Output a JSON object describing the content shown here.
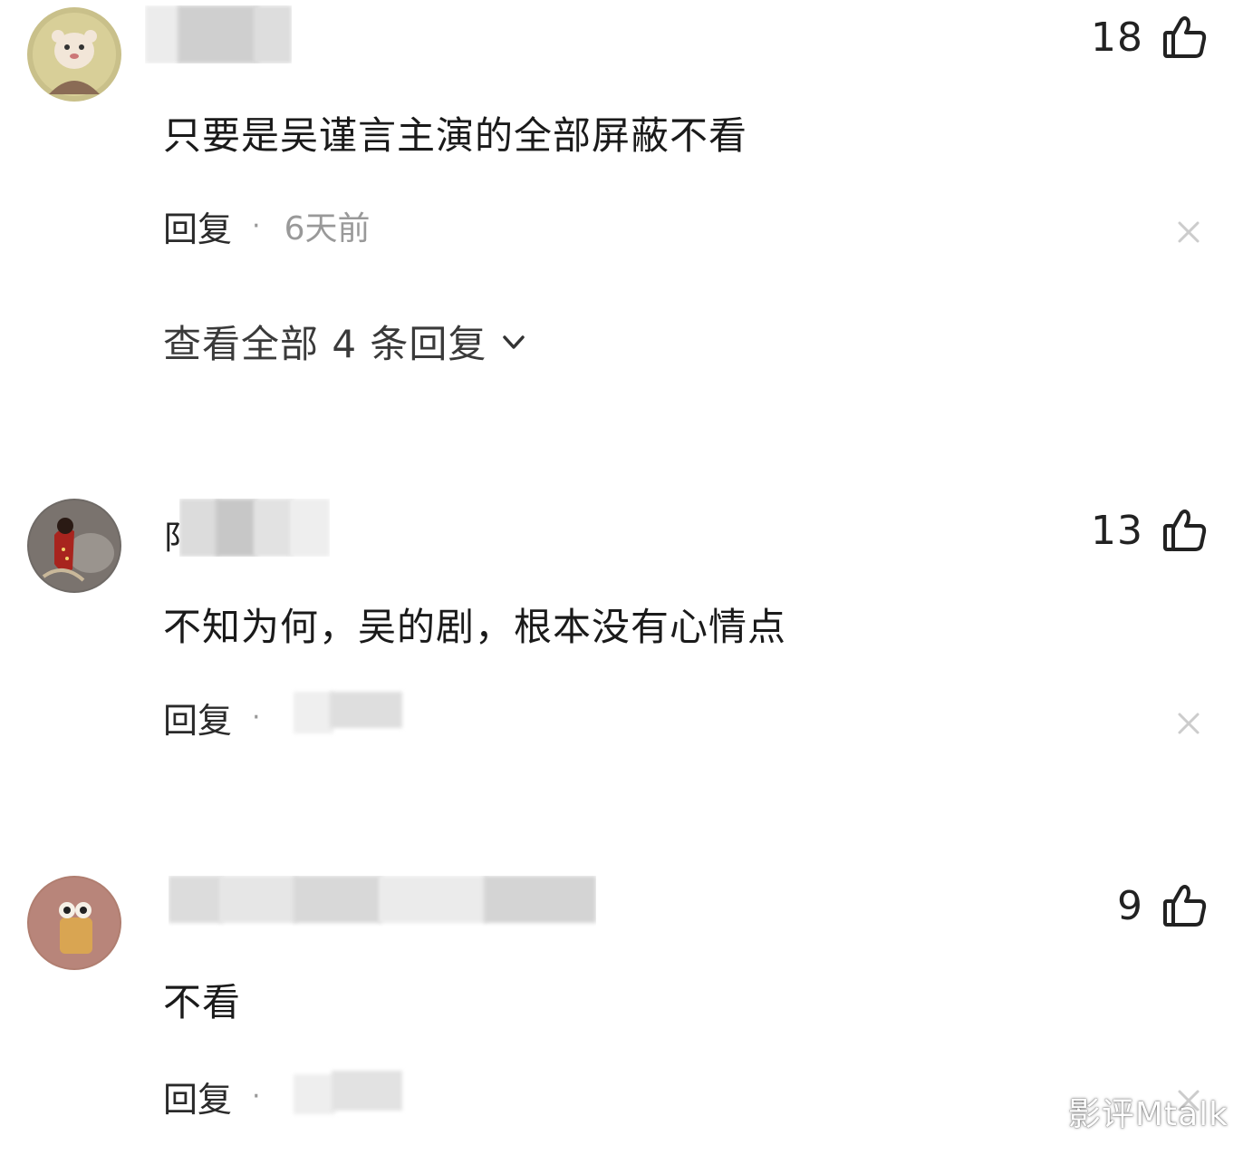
{
  "comments": [
    {
      "name_prefix": "",
      "like_count": "18",
      "text": "只要是吴谨言主演的全部屏蔽不看",
      "reply_label": "回复",
      "separator": "·",
      "time": "6天前",
      "view_replies": "查看全部 4 条回复"
    },
    {
      "name_prefix": "阝",
      "like_count": "13",
      "text": "不知为何，吴的剧，根本没有心情点",
      "reply_label": "回复",
      "separator": "·",
      "time": ""
    },
    {
      "name_prefix": "",
      "like_count": "9",
      "text": "不看",
      "reply_label": "回复",
      "separator": "·",
      "time": ""
    }
  ],
  "watermark": "影评Mtalk",
  "icons": {
    "like": "thumbs-up-icon",
    "close": "close-icon",
    "expand": "chevron-down-icon"
  },
  "colors": {
    "text_primary": "#1a1a1a",
    "text_muted": "#999999",
    "icon_line": "#222222",
    "close_gray": "#cccccc"
  }
}
